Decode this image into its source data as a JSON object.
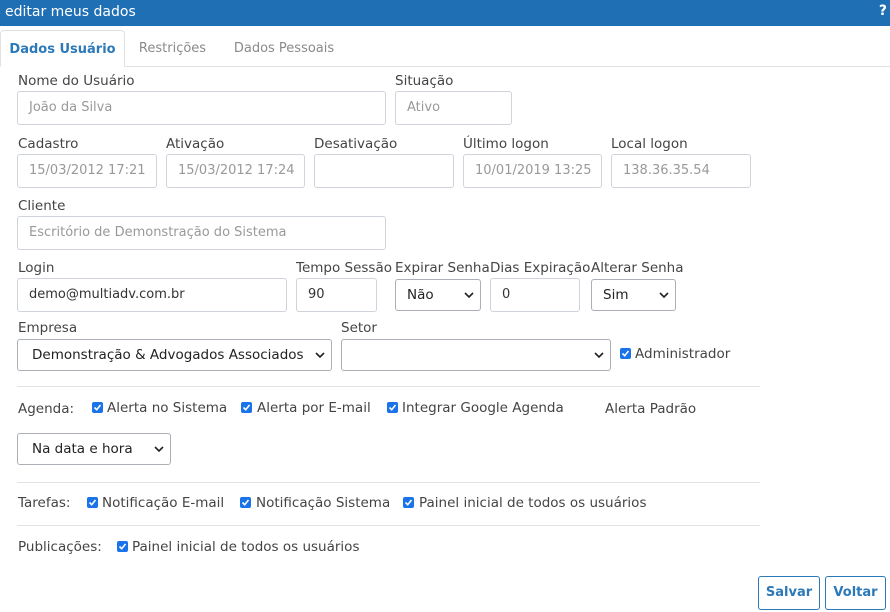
{
  "window": {
    "title": "editar meus dados",
    "help": "?"
  },
  "tabs": [
    {
      "label": "Dados Usuário"
    },
    {
      "label": "Restrições"
    },
    {
      "label": "Dados Pessoais"
    }
  ],
  "fields": {
    "nome_usuario": {
      "label": "Nome do Usuário",
      "value": "João da Silva"
    },
    "situacao": {
      "label": "Situação",
      "value": "Ativo"
    },
    "cadastro": {
      "label": "Cadastro",
      "value": "15/03/2012 17:21"
    },
    "ativacao": {
      "label": "Ativação",
      "value": "15/03/2012 17:24"
    },
    "desativacao": {
      "label": "Desativação",
      "value": ""
    },
    "ultimo_logon": {
      "label": "Último logon",
      "value": "10/01/2019 13:25"
    },
    "local_logon": {
      "label": "Local logon",
      "value": "138.36.35.54"
    },
    "cliente": {
      "label": "Cliente",
      "value": "Escritório de Demonstração do Sistema"
    },
    "login": {
      "label": "Login",
      "value": "demo@multiadv.com.br"
    },
    "tempo_sessao": {
      "label": "Tempo Sessão",
      "value": "90"
    },
    "expirar_senha": {
      "label": "Expirar Senha",
      "value": "Não"
    },
    "dias_expiracao": {
      "label": "Dias Expiração",
      "value": "0"
    },
    "alterar_senha": {
      "label": "Alterar Senha",
      "value": "Sim"
    },
    "empresa": {
      "label": "Empresa",
      "value": "Demonstração & Advogados Associados"
    },
    "setor": {
      "label": "Setor",
      "value": ""
    },
    "administrador": {
      "label": "Administrador",
      "checked": true
    }
  },
  "agenda": {
    "label": "Agenda:",
    "options": [
      {
        "label": "Alerta no Sistema",
        "checked": true
      },
      {
        "label": "Alerta por E-mail",
        "checked": true
      },
      {
        "label": "Integrar Google Agenda",
        "checked": true
      }
    ],
    "alerta_padrao_label": "Alerta Padrão",
    "alerta_padrao_value": "Na data e hora"
  },
  "tarefas": {
    "label": "Tarefas:",
    "options": [
      {
        "label": "Notificação E-mail",
        "checked": true
      },
      {
        "label": "Notificação Sistema",
        "checked": true
      },
      {
        "label": "Painel inicial de todos os usuários",
        "checked": true
      }
    ]
  },
  "publicacoes": {
    "label": "Publicações:",
    "options": [
      {
        "label": "Painel inicial de todos os usuários",
        "checked": true
      }
    ]
  },
  "buttons": {
    "save": "Salvar",
    "back": "Voltar"
  },
  "colors": {
    "accent": "#2b79b8",
    "titlebar": "#1f6fb5",
    "checkbox": "#1a73e8"
  }
}
